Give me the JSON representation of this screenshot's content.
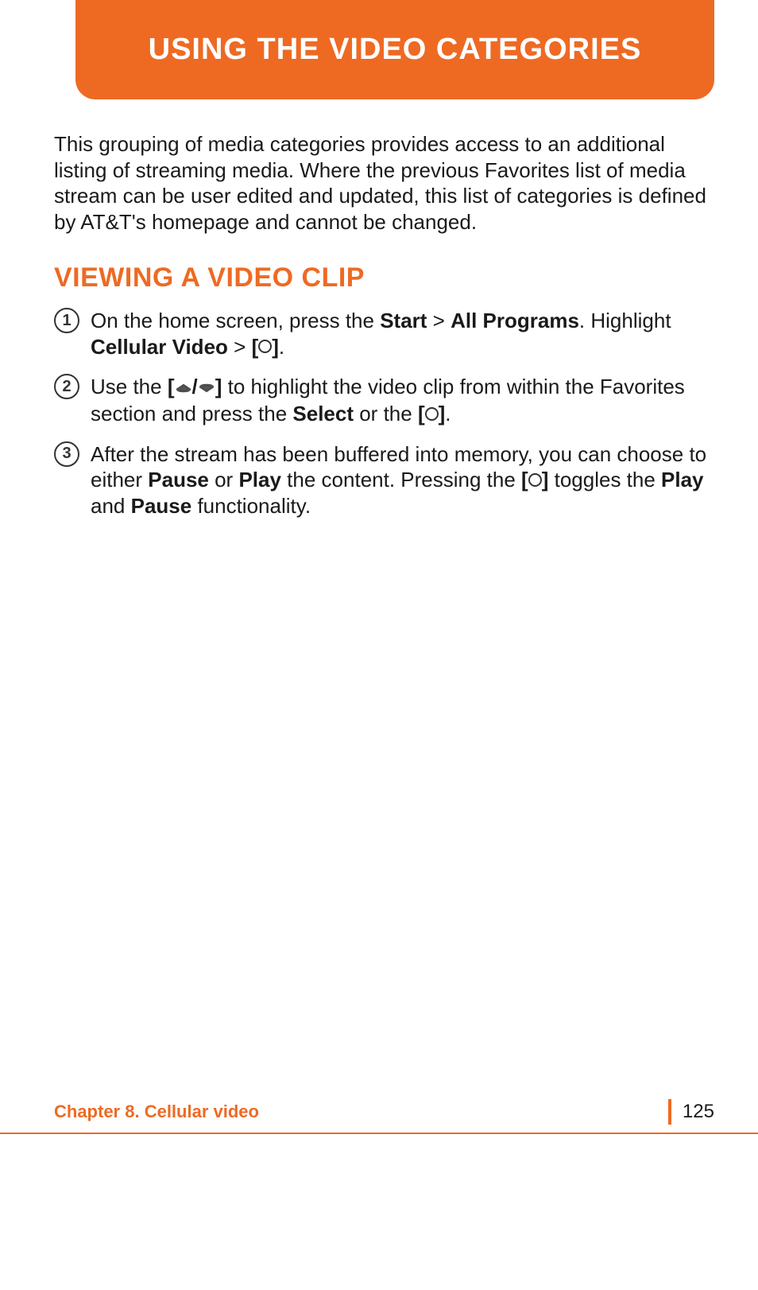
{
  "header": {
    "title": "USING THE VIDEO CATEGORIES"
  },
  "intro": "This grouping of media categories provides access to an additional listing of streaming media. Where the previous Favorites list of media stream can be user edited and updated, this list of categories is defined by AT&T's homepage and cannot be changed.",
  "section": {
    "heading": "VIEWING A VIDEO CLIP"
  },
  "steps": [
    {
      "number": "1",
      "parts": {
        "p1": "On the home screen, press the ",
        "b1": "Start",
        "p2": " > ",
        "b2": "All Programs",
        "p3": ". Highlight ",
        "b3": "Cellular Video",
        "p4": " > ",
        "b4": "[",
        "b5": "]",
        "p5": "."
      }
    },
    {
      "number": "2",
      "parts": {
        "p1": "Use the ",
        "b1": "[",
        "b2": "/",
        "b3": "]",
        "p2": " to highlight the video clip from within the Favorites section and press the ",
        "b4": "Select",
        "p3": " or the ",
        "b5": "[",
        "b6": "]",
        "p4": "."
      }
    },
    {
      "number": "3",
      "parts": {
        "p1": "After the stream has been buffered into memory, you can choose to either ",
        "b1": "Pause",
        "p2": " or ",
        "b2": "Play",
        "p3": " the content. Pressing the ",
        "b3": "[",
        "b4": "]",
        "p4": " toggles the ",
        "b5": "Play",
        "p5": " and ",
        "b6": "Pause",
        "p6": " functionality."
      }
    }
  ],
  "footer": {
    "chapter": "Chapter 8. Cellular video",
    "page": "125"
  }
}
